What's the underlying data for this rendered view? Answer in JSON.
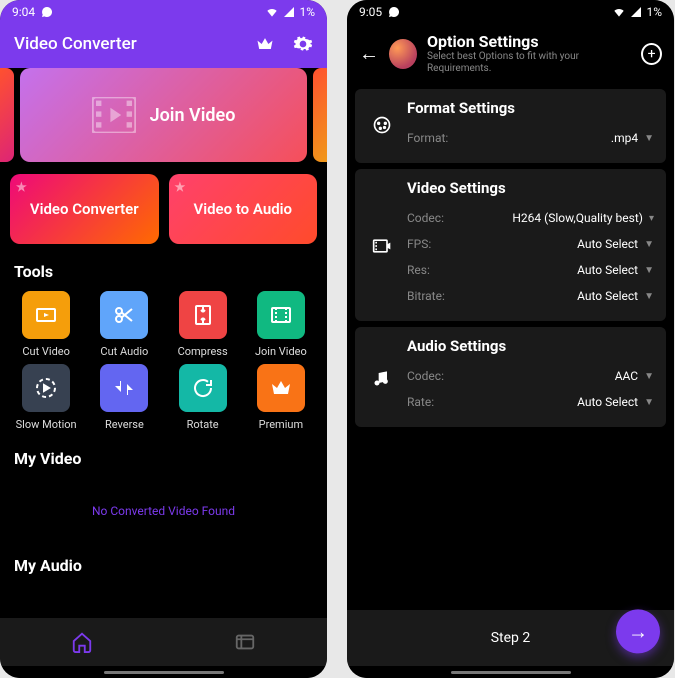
{
  "left": {
    "status": {
      "time": "9:04",
      "battery": "1%"
    },
    "header": {
      "title": "Video Converter"
    },
    "hero": {
      "label": "Join Video"
    },
    "featured": [
      {
        "label": "Video Converter"
      },
      {
        "label": "Video to Audio"
      }
    ],
    "sections": {
      "tools": "Tools",
      "myvideo": "My Video",
      "myaudio": "My Audio"
    },
    "tools": [
      {
        "label": "Cut Video",
        "color": "#f59e0b",
        "icon": "cut-video-icon"
      },
      {
        "label": "Cut Audio",
        "color": "#60a5fa",
        "icon": "cut-audio-icon"
      },
      {
        "label": "Compress",
        "color": "#ef4444",
        "icon": "compress-icon"
      },
      {
        "label": "Join Video",
        "color": "#10b981",
        "icon": "join-video-icon"
      },
      {
        "label": "Slow Motion",
        "color": "#374151",
        "icon": "slow-motion-icon"
      },
      {
        "label": "Reverse",
        "color": "#6366f1",
        "icon": "reverse-icon"
      },
      {
        "label": "Rotate",
        "color": "#14b8a6",
        "icon": "rotate-icon"
      },
      {
        "label": "Premium",
        "color": "#f97316",
        "icon": "premium-icon"
      }
    ],
    "empty_video": "No Converted Video Found"
  },
  "right": {
    "status": {
      "time": "9:05",
      "battery": "1%"
    },
    "header": {
      "title": "Option Settings",
      "subtitle": "Select best Options to fit with your Requirements."
    },
    "format": {
      "title": "Format Settings",
      "rows": {
        "format_label": "Format:",
        "format_value": ".mp4"
      }
    },
    "video": {
      "title": "Video Settings",
      "codec_label": "Codec:",
      "codec_value": "H264 (Slow,Quality best)",
      "fps_label": "FPS:",
      "fps_value": "Auto Select",
      "res_label": "Res:",
      "res_value": "Auto Select",
      "bitrate_label": "Bitrate:",
      "bitrate_value": "Auto Select"
    },
    "audio": {
      "title": "Audio Settings",
      "codec_label": "Codec:",
      "codec_value": "AAC",
      "rate_label": "Rate:",
      "rate_value": "Auto Select"
    },
    "step": "Step 2"
  }
}
